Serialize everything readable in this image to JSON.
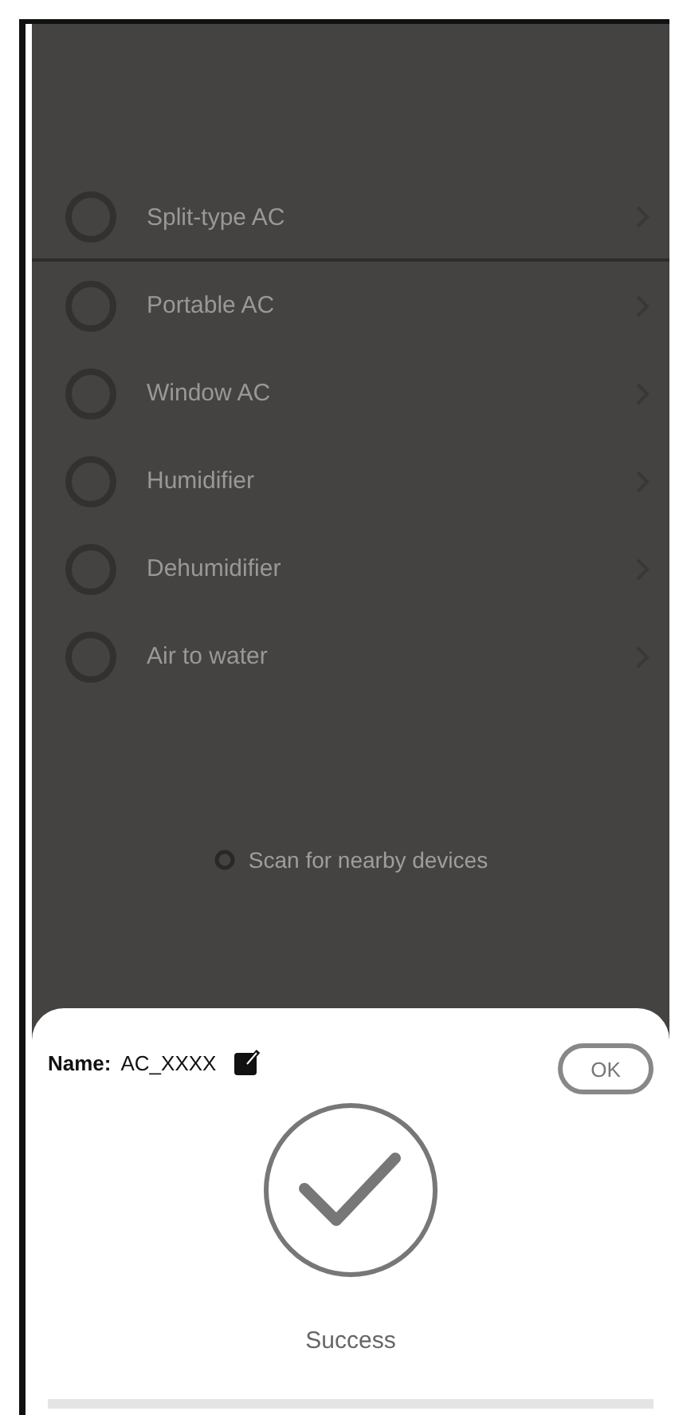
{
  "device_types": [
    {
      "label": "Split-type AC"
    },
    {
      "label": "Portable AC"
    },
    {
      "label": "Window AC"
    },
    {
      "label": "Humidifier"
    },
    {
      "label": "Dehumidifier"
    },
    {
      "label": "Air to water"
    }
  ],
  "scan_button": {
    "label": "Scan for nearby devices"
  },
  "sheet": {
    "name_label": "Name:",
    "name_value": "AC_XXXX",
    "ok_button": "OK",
    "status": "Success"
  }
}
